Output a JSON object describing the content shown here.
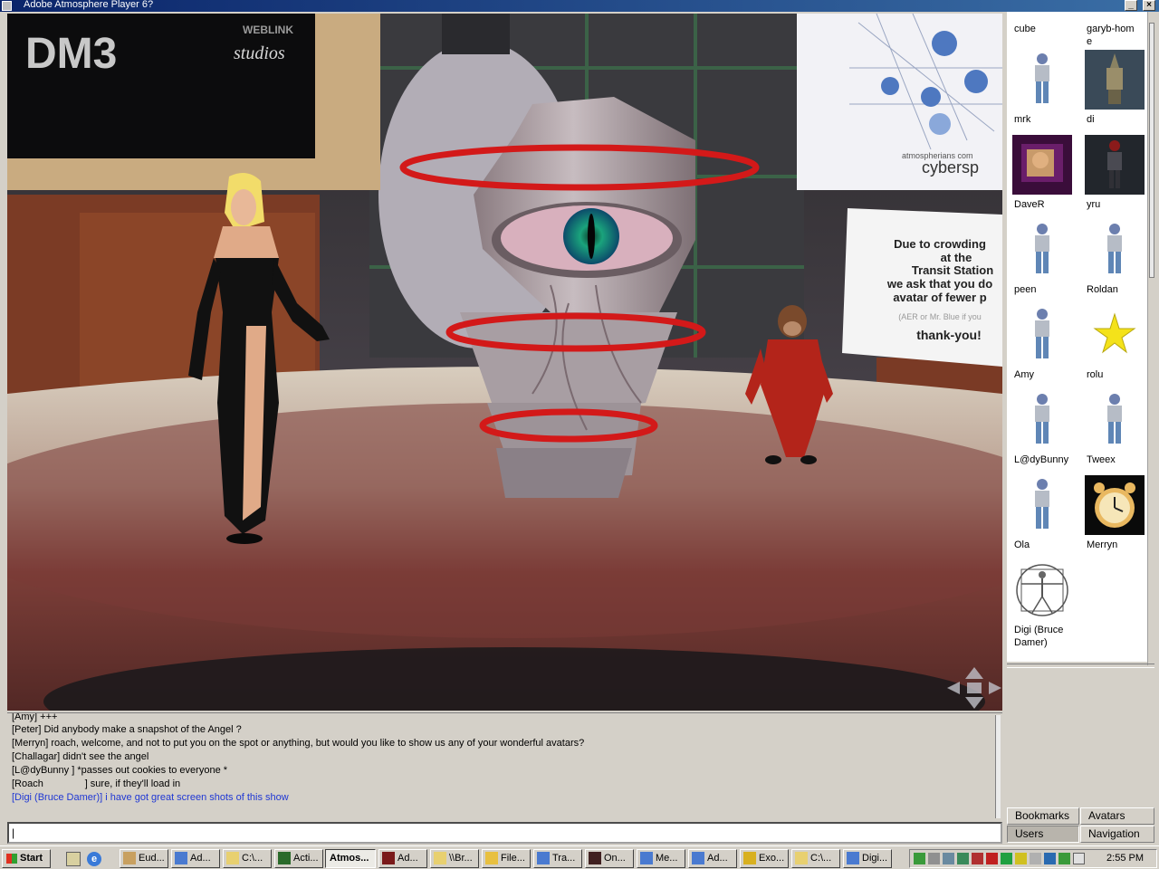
{
  "window": {
    "title": "Adobe Atmosphere Player 6?"
  },
  "scene": {
    "banner_brand": "WEBLINK",
    "banner_logo": "DM3",
    "banner_studio": "studios",
    "poster_brand": "atmospherians com",
    "poster_title": "cybersp",
    "notice_lines": [
      "Due to crowding",
      "at the",
      "Transit Station",
      "we ask that you do",
      "avatar of fewer p",
      "(AER or Mr. Blue if you"
    ],
    "notice_closing": "thank-you!",
    "nav_arrows_icon": "navigation-arrows-icon"
  },
  "chat": {
    "lines": [
      "[Amy] +++",
      "[Peter] Did anybody make a snapshot of the Angel ?",
      "[Merryn] roach, welcome, and not to put you on the spot or anything, but would you like to show us any of your wonderful avatars?",
      "[Challagar] didn't see the angel",
      "[L@dyBunny ] *passes out cookies to everyone *",
      "[Roach               ] sure, if they'll load in",
      "[Digi (Bruce Damer)] i have got great screen shots of this show"
    ],
    "self_line_color": "#1f37d4",
    "input_value": "|"
  },
  "users": [
    {
      "name": "cube",
      "avatar": "none"
    },
    {
      "name": "garyb-home",
      "avatar": "none"
    },
    {
      "name": "mrk",
      "avatar": "default-avatar-icon"
    },
    {
      "name": "di",
      "avatar": "robot-avatar-icon"
    },
    {
      "name": "DaveR",
      "avatar": "photo-avatar-icon"
    },
    {
      "name": "yru",
      "avatar": "dark-robot-avatar-icon"
    },
    {
      "name": "peen",
      "avatar": "default-avatar-icon"
    },
    {
      "name": "Roldan",
      "avatar": "default-avatar-icon"
    },
    {
      "name": "Amy",
      "avatar": "default-avatar-icon"
    },
    {
      "name": "rolu",
      "avatar": "star-avatar-icon"
    },
    {
      "name": "L@dyBunny",
      "avatar": "default-avatar-icon"
    },
    {
      "name": "Tweex",
      "avatar": "default-avatar-icon"
    },
    {
      "name": "Ola",
      "avatar": "default-avatar-icon"
    },
    {
      "name": "Merryn",
      "avatar": "clock-avatar-icon"
    },
    {
      "name": "Digi (Bruce Damer)",
      "avatar": "vitruvian-avatar-icon"
    }
  ],
  "user_rows": {
    "r0a": "cube",
    "r0b": "garyb-hom",
    "r0b2": "e",
    "r1a": "mrk",
    "r1b": "di",
    "r2a": "DaveR",
    "r2b": "yru",
    "r3a": "peen",
    "r3b": "Roldan",
    "r4a": "Amy",
    "r4b": "rolu",
    "r5a": "L@dyBunny",
    "r5b": "Tweex",
    "r6a": "Ola",
    "r6b": "Merryn",
    "r7a": "Digi (Bruce",
    "r7a2": "Damer)"
  },
  "panel_tabs": {
    "bookmarks": "Bookmarks",
    "avatars": "Avatars",
    "users": "Users",
    "navigation": "Navigation",
    "active": "Users"
  },
  "taskbar": {
    "start": "Start",
    "quick_launch": [
      "show-desktop-icon",
      "internet-explorer-icon"
    ],
    "tasks": [
      {
        "label": "Eud...",
        "icon": "eudora-icon"
      },
      {
        "label": "Ad...",
        "icon": "ie-icon"
      },
      {
        "label": "C:\\...",
        "icon": "folder-icon"
      },
      {
        "label": "Acti...",
        "icon": "activeworlds-icon"
      },
      {
        "label": "Atmos...",
        "icon": "atmosphere-icon",
        "active": true
      },
      {
        "label": "Ad...",
        "icon": "adobe-icon"
      },
      {
        "label": "\\\\Br...",
        "icon": "folder-icon"
      },
      {
        "label": "File...",
        "icon": "file-icon"
      },
      {
        "label": "Tra...",
        "icon": "ie-icon"
      },
      {
        "label": "On...",
        "icon": "movie-icon"
      },
      {
        "label": "Me...",
        "icon": "ie-icon"
      },
      {
        "label": "Ad...",
        "icon": "ie-icon"
      },
      {
        "label": "Exo...",
        "icon": "exodus-icon"
      },
      {
        "label": "C:\\...",
        "icon": "folder-icon"
      },
      {
        "label": "Digi...",
        "icon": "ie-icon"
      }
    ],
    "clock": "2:55 PM"
  }
}
